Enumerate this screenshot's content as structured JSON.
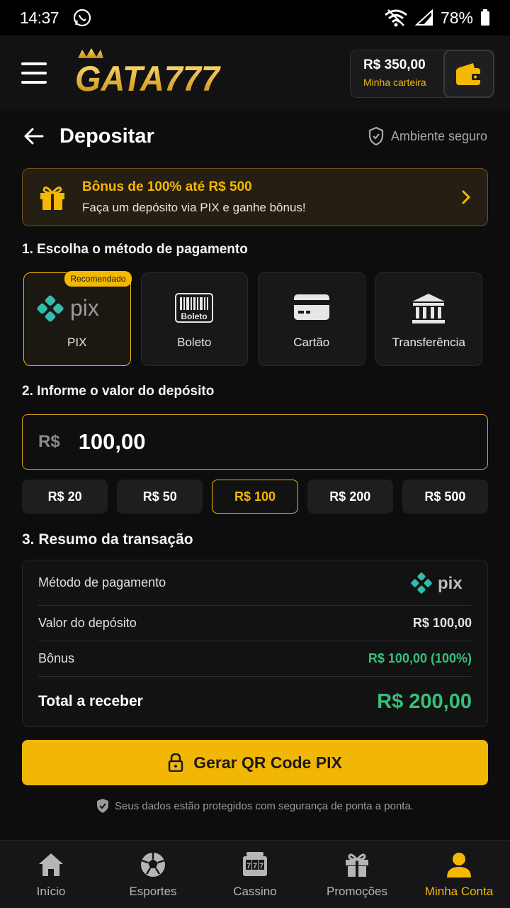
{
  "status": {
    "time": "14:37",
    "battery": "78%"
  },
  "header": {
    "logo_text": "GATA777",
    "wallet_amount": "R$ 350,00",
    "wallet_label": "Minha carteira"
  },
  "page": {
    "title": "Depositar",
    "secure_label": "Ambiente seguro"
  },
  "bonus": {
    "title": "Bônus de 100% até R$ 500",
    "subtitle": "Faça um depósito via PIX e ganhe bônus!"
  },
  "step1": "1. Escolha o método de pagamento",
  "methods": [
    {
      "label": "PIX",
      "icon": "pix-icon",
      "badge": "Recomendado",
      "selected": true
    },
    {
      "label": "Boleto",
      "icon": "barcode-icon",
      "selected": false
    },
    {
      "label": "Cartão",
      "icon": "card-icon",
      "selected": false
    },
    {
      "label": "Transferência",
      "icon": "bank-icon",
      "selected": false
    }
  ],
  "step2": "2. Informe o valor do depósito",
  "amount": {
    "currency": "R$",
    "value": "100,00"
  },
  "quick_amounts": [
    "R$ 20",
    "R$ 50",
    "R$ 100",
    "R$ 200",
    "R$ 500"
  ],
  "step3": "3. Resumo da transação",
  "summary": {
    "method_label": "Método de pagamento",
    "method_value": "pix",
    "deposit_label": "Valor do depósito",
    "deposit_value": "R$ 100,00",
    "bonus_label": "Bônus",
    "bonus_value": "R$ 100,00 (100%)",
    "total_label": "Total a receber",
    "total_value": "R$ 200,00"
  },
  "cta": "Gerar QR Code PIX",
  "footer_note": "Seus dados estão protegidos com segurança de ponta a ponta.",
  "nav": [
    "Início",
    "Esportes",
    "Cassino",
    "Promoções",
    "Minha Conta"
  ],
  "colors": {
    "accent": "#f5b800",
    "positive": "#35c07a",
    "pix": "#32bcad"
  }
}
